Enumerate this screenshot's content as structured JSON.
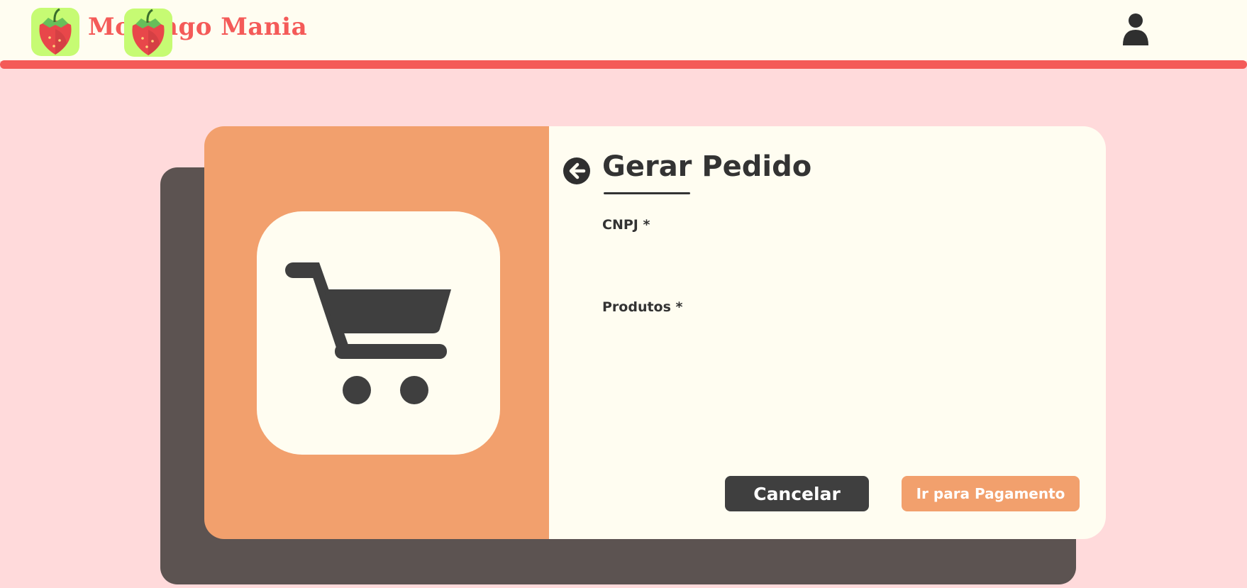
{
  "header": {
    "brand_name": "Morango Mania",
    "logo_icon": "strawberry-icon",
    "user_icon": "user-icon"
  },
  "illustration": {
    "icon": "shopping-cart-icon"
  },
  "form": {
    "back_icon": "arrow-left-circle-icon",
    "title": "Gerar Pedido",
    "cnpj_label": "CNPJ *",
    "produtos_label": "Produtos *"
  },
  "actions": {
    "cancel_label": "Cancelar",
    "pay_label": "Ir para Pagamento"
  },
  "colors": {
    "page_background": "#ffdadb",
    "header_background": "#fffdf1",
    "brand_red": "#f45a58",
    "logo_green": "#c6fb73",
    "accent_orange": "#f2a06d",
    "dark": "#3f3f3f",
    "shadow": "#5c5351"
  }
}
